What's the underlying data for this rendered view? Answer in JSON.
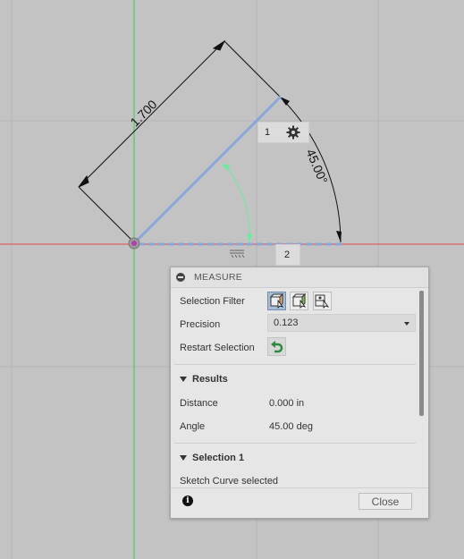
{
  "canvas": {
    "dimension_value": "1.700",
    "angle_value": "45.00°",
    "point1_label": "1",
    "point2_label": "2"
  },
  "panel": {
    "title": "MEASURE",
    "selection_filter_label": "Selection Filter",
    "precision_label": "Precision",
    "precision_value": "0.123",
    "restart_label": "Restart Selection",
    "results_header": "Results",
    "distance_label": "Distance",
    "distance_value": "0.000 in",
    "angle_label": "Angle",
    "angle_value": "45.00 deg",
    "selection1_header": "Selection 1",
    "selection1_text": "Sketch Curve selected",
    "close_label": "Close"
  },
  "colors": {
    "background": "#c3c3c3",
    "grid": "#b4b4b4",
    "axis_green": "#33cc55",
    "axis_red": "#e04848",
    "selected_line": "#8aa7dc",
    "dimension": "#111111",
    "angle_arc": "#66ee99"
  },
  "icons": [
    "gear-icon",
    "constraint-icon",
    "face-filter-icon",
    "edge-filter-icon",
    "body-filter-icon",
    "restart-icon",
    "info-icon",
    "collapse-icon",
    "chevron-down-icon"
  ]
}
